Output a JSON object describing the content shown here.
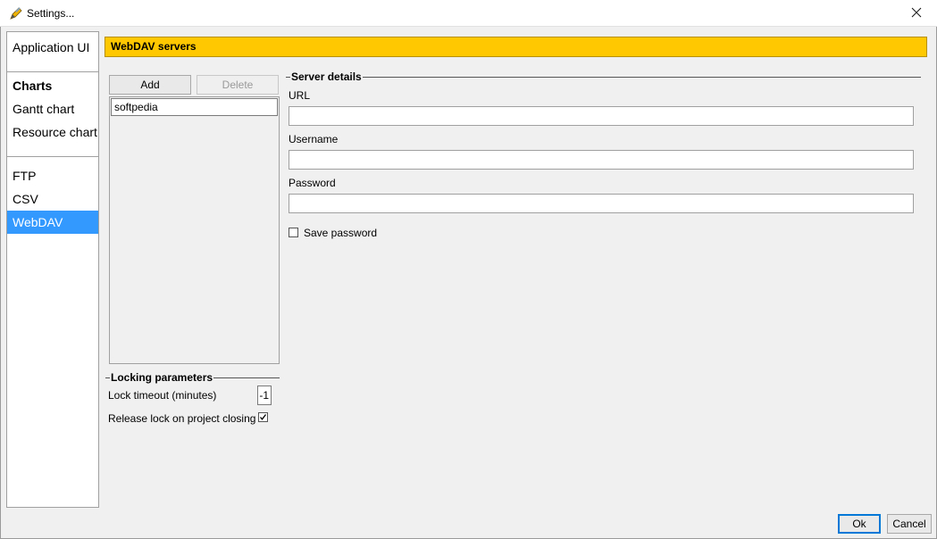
{
  "window": {
    "title": "Settings...",
    "app_icon": "pen-icon",
    "close_icon": "close-icon"
  },
  "sidebar": {
    "items": [
      {
        "label": "Application UI",
        "selected": false,
        "bold": false
      },
      {
        "label": "Charts",
        "selected": false,
        "bold": true
      },
      {
        "label": "Gantt chart",
        "selected": false,
        "bold": false
      },
      {
        "label": "Resource chart",
        "selected": false,
        "bold": false
      },
      {
        "label": "FTP",
        "selected": false,
        "bold": false
      },
      {
        "label": "CSV",
        "selected": false,
        "bold": false
      },
      {
        "label": "WebDAV",
        "selected": true,
        "bold": false
      }
    ]
  },
  "header": {
    "title": "WebDAV servers",
    "color": "#ffc800"
  },
  "servers": {
    "add_label": "Add",
    "delete_label": "Delete",
    "list": [
      "softpedia"
    ]
  },
  "server_details": {
    "title": "Server details",
    "url_label": "URL",
    "url_value": "",
    "username_label": "Username",
    "username_value": "",
    "password_label": "Password",
    "password_value": "",
    "save_password_label": "Save password",
    "save_password_checked": false
  },
  "locking": {
    "title": "Locking parameters",
    "timeout_label": "Lock timeout (minutes)",
    "timeout_value": "-1",
    "release_label": "Release lock on project closing",
    "release_checked": true
  },
  "footer": {
    "ok_label": "Ok",
    "cancel_label": "Cancel"
  },
  "colors": {
    "selection": "#3399ff",
    "header": "#ffc800"
  }
}
